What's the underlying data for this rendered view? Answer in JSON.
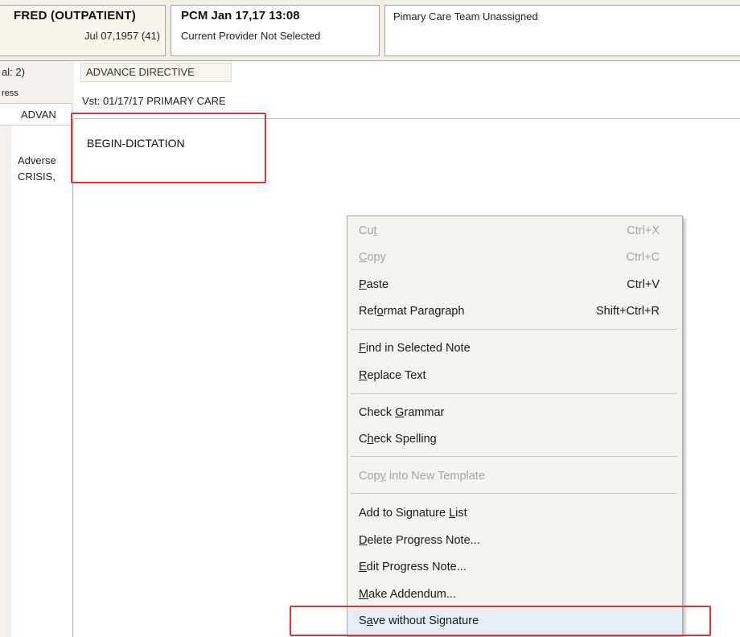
{
  "header": {
    "patient_name": "FRED (OUTPATIENT)",
    "patient_dob": "Jul 07,1957 (41)",
    "pcm_title": "PCM Jan 17,17 13:08",
    "pcm_subtitle": "Current Provider Not Selected",
    "care_team": "Pimary Care Team Unassigned"
  },
  "left_panel": {
    "total_label": "al: 2)",
    "tab_label": "ress",
    "note_tab": "ADVAN",
    "note_preview_line1": "Adverse",
    "note_preview_line2": "CRISIS,"
  },
  "note": {
    "title": "ADVANCE DIRECTIVE",
    "visit": "Vst: 01/17/17  PRIMARY CARE",
    "body_text": "BEGIN-DICTATION"
  },
  "context_menu": {
    "items": [
      {
        "label": "Cut",
        "mnemonic": "t",
        "shortcut": "Ctrl+X",
        "disabled": true
      },
      {
        "label": "Copy",
        "mnemonic": "C",
        "shortcut": "Ctrl+C",
        "disabled": true
      },
      {
        "label": "Paste",
        "mnemonic": "P",
        "shortcut": "Ctrl+V",
        "disabled": false
      },
      {
        "label": "Reformat Paragraph",
        "mnemonic": "o",
        "shortcut": "Shift+Ctrl+R",
        "disabled": false
      },
      {
        "label": "Find in Selected Note",
        "mnemonic": "F",
        "shortcut": "",
        "disabled": false
      },
      {
        "label": "Replace Text",
        "mnemonic": "R",
        "shortcut": "",
        "disabled": false
      },
      {
        "label": "Check Grammar",
        "mnemonic": "G",
        "shortcut": "",
        "disabled": false
      },
      {
        "label": "Check Spelling",
        "mnemonic": "h",
        "shortcut": "",
        "disabled": false
      },
      {
        "label": "Copy into New Template",
        "mnemonic": "y",
        "shortcut": "",
        "disabled": true
      },
      {
        "label": "Add to Signature List",
        "mnemonic": "L",
        "shortcut": "",
        "disabled": false
      },
      {
        "label": "Delete Progress Note...",
        "mnemonic": "D",
        "shortcut": "",
        "disabled": false
      },
      {
        "label": "Edit Progress Note...",
        "mnemonic": "E",
        "shortcut": "",
        "disabled": false
      },
      {
        "label": "Make Addendum...",
        "mnemonic": "M",
        "shortcut": "",
        "disabled": false
      },
      {
        "label": "Save without Signature",
        "mnemonic": "a",
        "shortcut": "",
        "disabled": false
      }
    ]
  },
  "colors": {
    "highlight_box": "#d9363a",
    "menu_hover": "#e5eef7",
    "disabled_text": "#a5a5a5"
  }
}
